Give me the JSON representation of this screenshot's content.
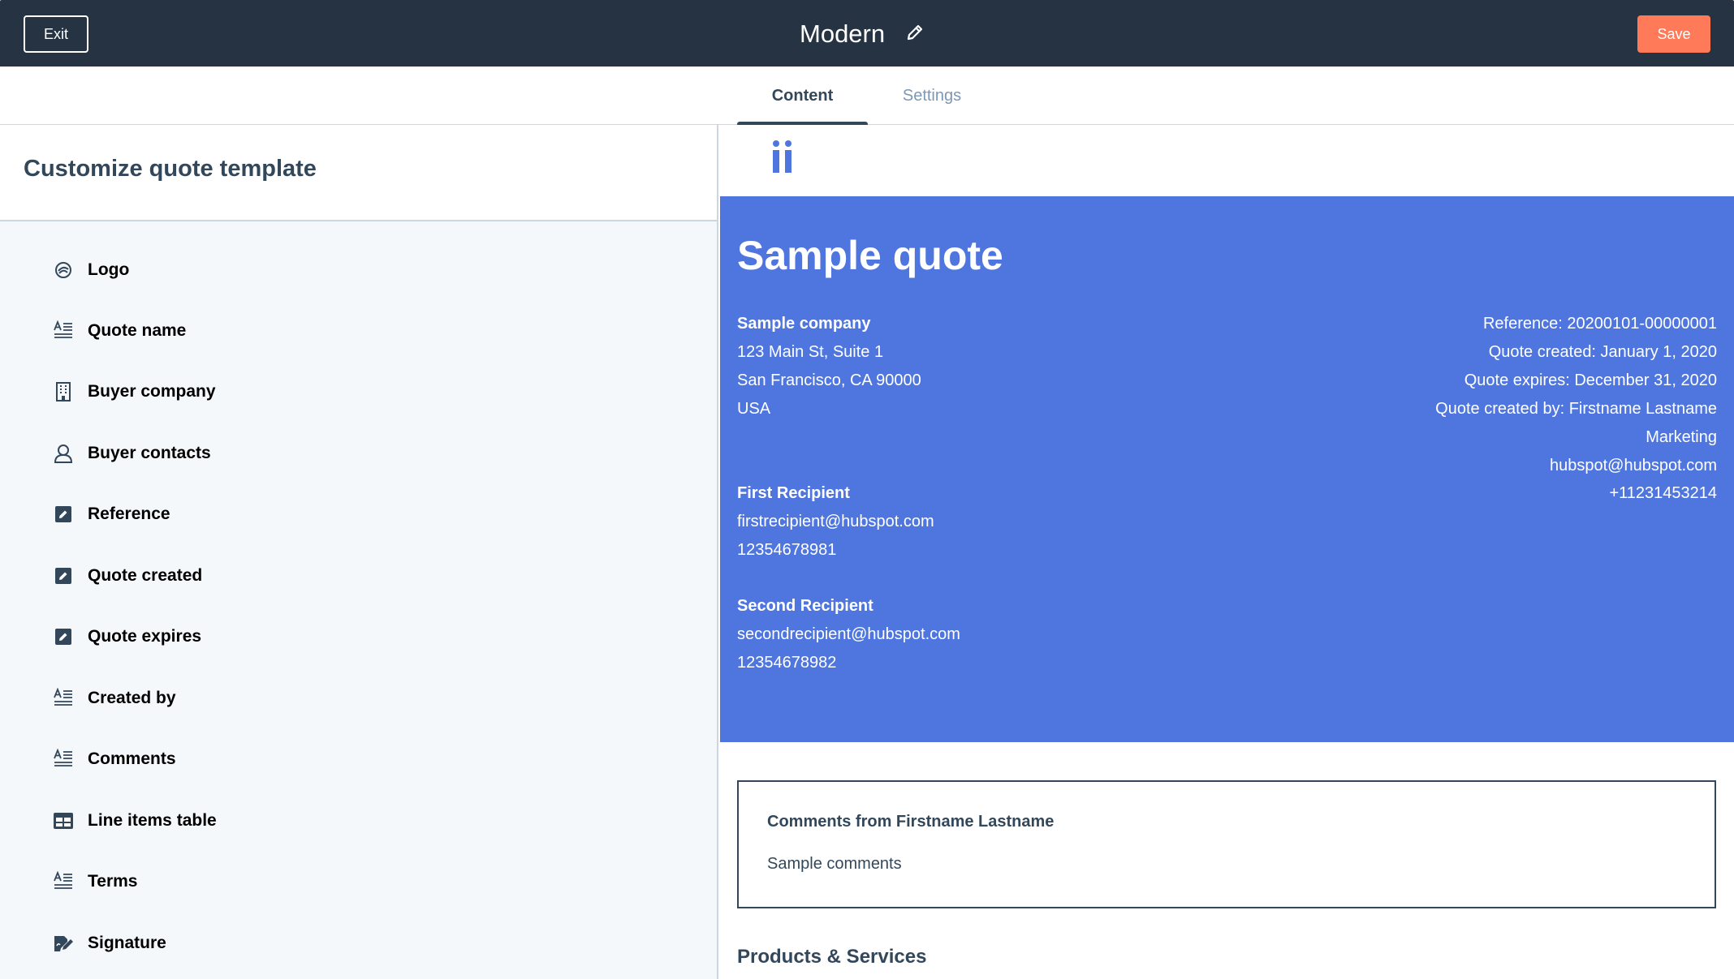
{
  "topbar": {
    "exit_label": "Exit",
    "title": "Modern",
    "save_label": "Save"
  },
  "tabs": [
    {
      "label": "Content",
      "active": true
    },
    {
      "label": "Settings",
      "active": false
    }
  ],
  "sidebar": {
    "heading": "Customize quote template",
    "modules": [
      {
        "label": "Logo",
        "icon": "logo-icon"
      },
      {
        "label": "Quote name",
        "icon": "text-icon"
      },
      {
        "label": "Buyer company",
        "icon": "building-icon"
      },
      {
        "label": "Buyer contacts",
        "icon": "contact-icon"
      },
      {
        "label": "Reference",
        "icon": "edit-field-icon"
      },
      {
        "label": "Quote created",
        "icon": "edit-field-icon"
      },
      {
        "label": "Quote expires",
        "icon": "edit-field-icon"
      },
      {
        "label": "Created by",
        "icon": "text-icon"
      },
      {
        "label": "Comments",
        "icon": "text-icon"
      },
      {
        "label": "Line items table",
        "icon": "table-icon"
      },
      {
        "label": "Terms",
        "icon": "text-icon"
      },
      {
        "label": "Signature",
        "icon": "signature-icon"
      }
    ]
  },
  "preview": {
    "title": "Sample quote",
    "company": {
      "name": "Sample company",
      "address1": "123 Main St, Suite 1",
      "address2": "San Francisco, CA 90000",
      "country": "USA"
    },
    "meta": {
      "reference": "Reference: 20200101-00000001",
      "created": "Quote created: January 1, 2020",
      "expires": "Quote expires: December 31, 2020",
      "created_by": "Quote created by: Firstname Lastname",
      "department": "Marketing",
      "email": "hubspot@hubspot.com",
      "phone": "+11231453214"
    },
    "recipients": [
      {
        "name": "First Recipient",
        "email": "firstrecipient@hubspot.com",
        "phone": "12354678981"
      },
      {
        "name": "Second Recipient",
        "email": "secondrecipient@hubspot.com",
        "phone": "12354678982"
      }
    ],
    "comments": {
      "title": "Comments from Firstname Lastname",
      "text": "Sample comments"
    },
    "products_heading": "Products & Services"
  },
  "colors": {
    "topbar": "#253342",
    "save_button": "#ff7a59",
    "hero": "#4f76df",
    "text_dark": "#33475b",
    "tab_inactive": "#7c98b6"
  }
}
